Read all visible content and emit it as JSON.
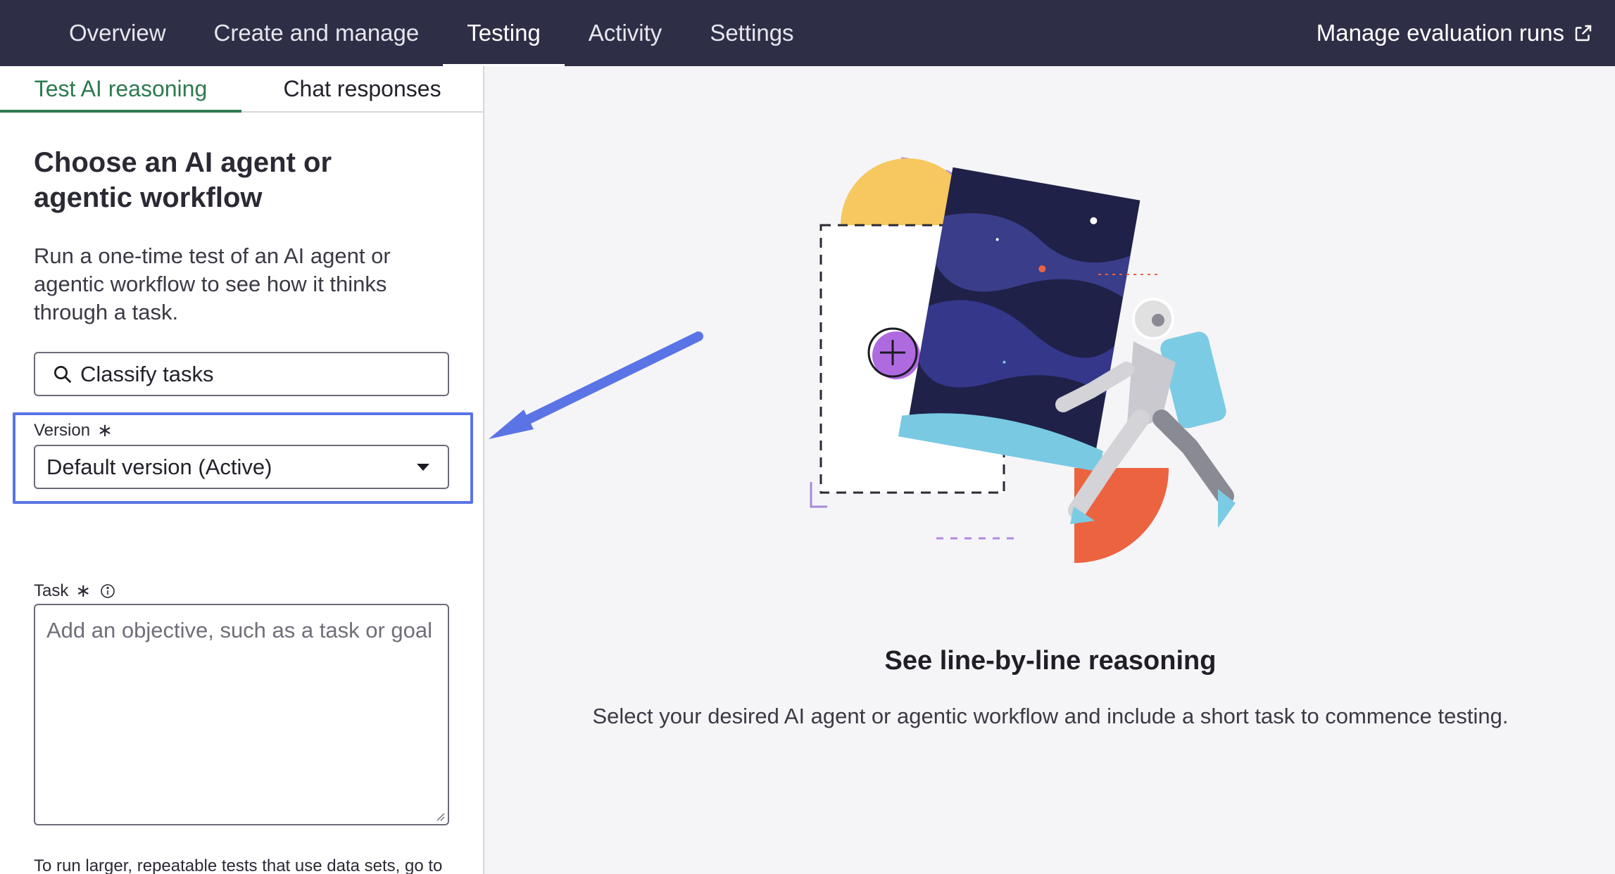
{
  "nav": {
    "tabs": [
      {
        "label": "Overview"
      },
      {
        "label": "Create and manage"
      },
      {
        "label": "Testing"
      },
      {
        "label": "Activity"
      },
      {
        "label": "Settings"
      }
    ],
    "active_tab": "Testing",
    "right_link": "Manage evaluation runs"
  },
  "subtabs": [
    {
      "label": "Test AI reasoning"
    },
    {
      "label": "Chat responses"
    }
  ],
  "panel": {
    "title": "Choose an AI agent or agentic workflow",
    "description": "Run a one-time test of an AI agent or agentic workflow to see how it thinks through a task.",
    "search_value": "Classify tasks",
    "version_label": "Version",
    "required_mark": "∗",
    "version_value": "Default version (Active)",
    "task_label": "Task",
    "task_placeholder": "Add an objective, such as a task or goal",
    "footnote": "To run larger, repeatable tests that use data sets, go to Skill Kit. These larger tests are called evaluation runs."
  },
  "main": {
    "heading": "See line-by-line reasoning",
    "subtext": "Select your desired AI agent or agentic workflow and include a short task to commence testing."
  },
  "colors": {
    "nav_bg": "#2e2e47",
    "accent_green": "#2d7a4e",
    "highlight_blue": "#5a74e6",
    "annotation_arrow": "#5a74e6"
  }
}
